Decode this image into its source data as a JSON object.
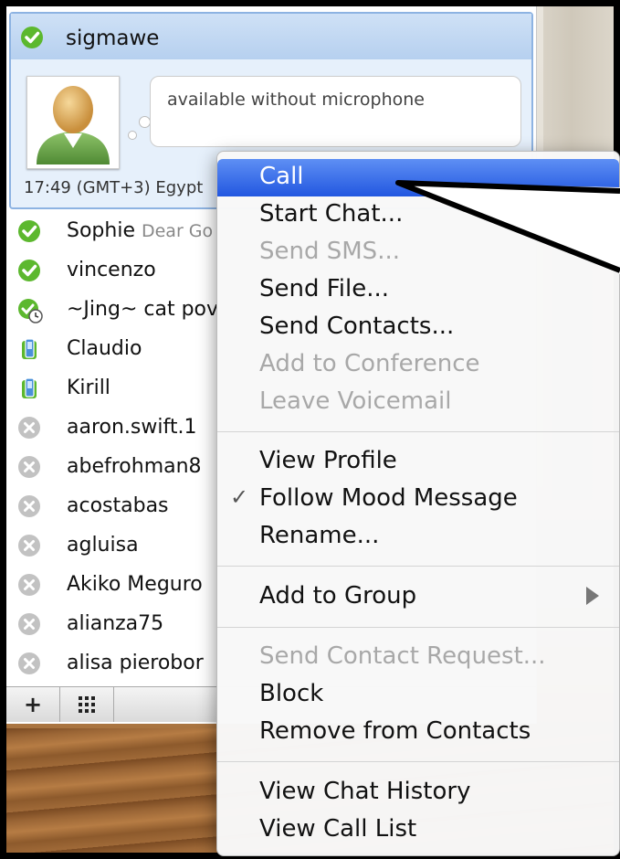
{
  "selected_contact": {
    "name": "sigmawe",
    "mood": "available without microphone",
    "time_location": "17:49 (GMT+3) Egypt"
  },
  "contacts": [
    {
      "name": "Sophie",
      "mood": "Dear Go",
      "status": "online"
    },
    {
      "name": "vincenzo",
      "mood": "",
      "status": "online"
    },
    {
      "name": "~Jing~",
      "mood": "cat pov",
      "status": "away"
    },
    {
      "name": "Claudio",
      "mood": "",
      "status": "mobile"
    },
    {
      "name": "Kirill",
      "mood": "",
      "status": "mobile"
    },
    {
      "name": "aaron.swift.1",
      "mood": "",
      "status": "offline"
    },
    {
      "name": "abefrohman8",
      "mood": "",
      "status": "offline"
    },
    {
      "name": "acostabas",
      "mood": "",
      "status": "offline"
    },
    {
      "name": "agluisa",
      "mood": "",
      "status": "offline"
    },
    {
      "name": "Akiko Meguro",
      "mood": "",
      "status": "offline"
    },
    {
      "name": "alianza75",
      "mood": "",
      "status": "offline"
    },
    {
      "name": "alisa pierobor",
      "mood": "",
      "status": "offline"
    }
  ],
  "toolbar": {
    "add_label": "+",
    "dialpad_icon": "dialpad-icon"
  },
  "context_menu": {
    "items": [
      {
        "label": "Call",
        "enabled": true,
        "highlighted": true
      },
      {
        "label": "Start Chat...",
        "enabled": true
      },
      {
        "label": "Send SMS...",
        "enabled": false
      },
      {
        "label": "Send File...",
        "enabled": true
      },
      {
        "label": "Send Contacts...",
        "enabled": true
      },
      {
        "label": "Add to Conference",
        "enabled": false
      },
      {
        "label": "Leave Voicemail",
        "enabled": false
      },
      {
        "label": "View Profile",
        "enabled": true
      },
      {
        "label": "Follow Mood Message",
        "enabled": true,
        "checked": true
      },
      {
        "label": "Rename...",
        "enabled": true
      },
      {
        "label": "Add to Group",
        "enabled": true,
        "submenu": true
      },
      {
        "label": "Send Contact Request...",
        "enabled": false
      },
      {
        "label": "Block",
        "enabled": true
      },
      {
        "label": "Remove from Contacts",
        "enabled": true
      },
      {
        "label": "View Chat History",
        "enabled": true
      },
      {
        "label": "View Call List",
        "enabled": true
      }
    ]
  },
  "colors": {
    "online": "#5cb82e",
    "offline": "#b9b9b9",
    "highlight": "#2f64e6"
  }
}
